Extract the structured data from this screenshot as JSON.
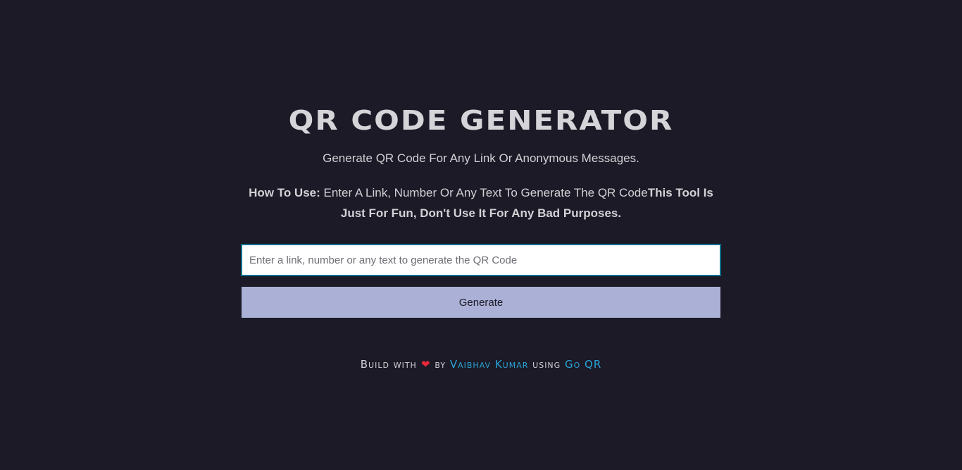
{
  "header": {
    "title": "QR CODE GENERATOR",
    "subtitle": "Generate QR Code For Any Link Or Anonymous Messages."
  },
  "instructions": {
    "label": "How To Use:",
    "text": " Enter A Link, Number Or Any Text To Generate The QR Code",
    "warning": "This Tool Is Just For Fun, Don't Use It For Any Bad Purposes."
  },
  "form": {
    "input_value": "",
    "input_placeholder": "Enter a link, number or any text to generate the QR Code",
    "button_label": "Generate"
  },
  "footer": {
    "build_with": "Build with",
    "heart": "❤",
    "by": "by",
    "author": "Vaibhav Kumar",
    "using": "using",
    "service": "Go QR"
  },
  "colors": {
    "background": "#1b1a26",
    "text": "#d2d1d6",
    "button": "#aab0d6",
    "link": "#2aa3d6",
    "heart": "#e8283a",
    "input_border": "#0e6f8a"
  }
}
